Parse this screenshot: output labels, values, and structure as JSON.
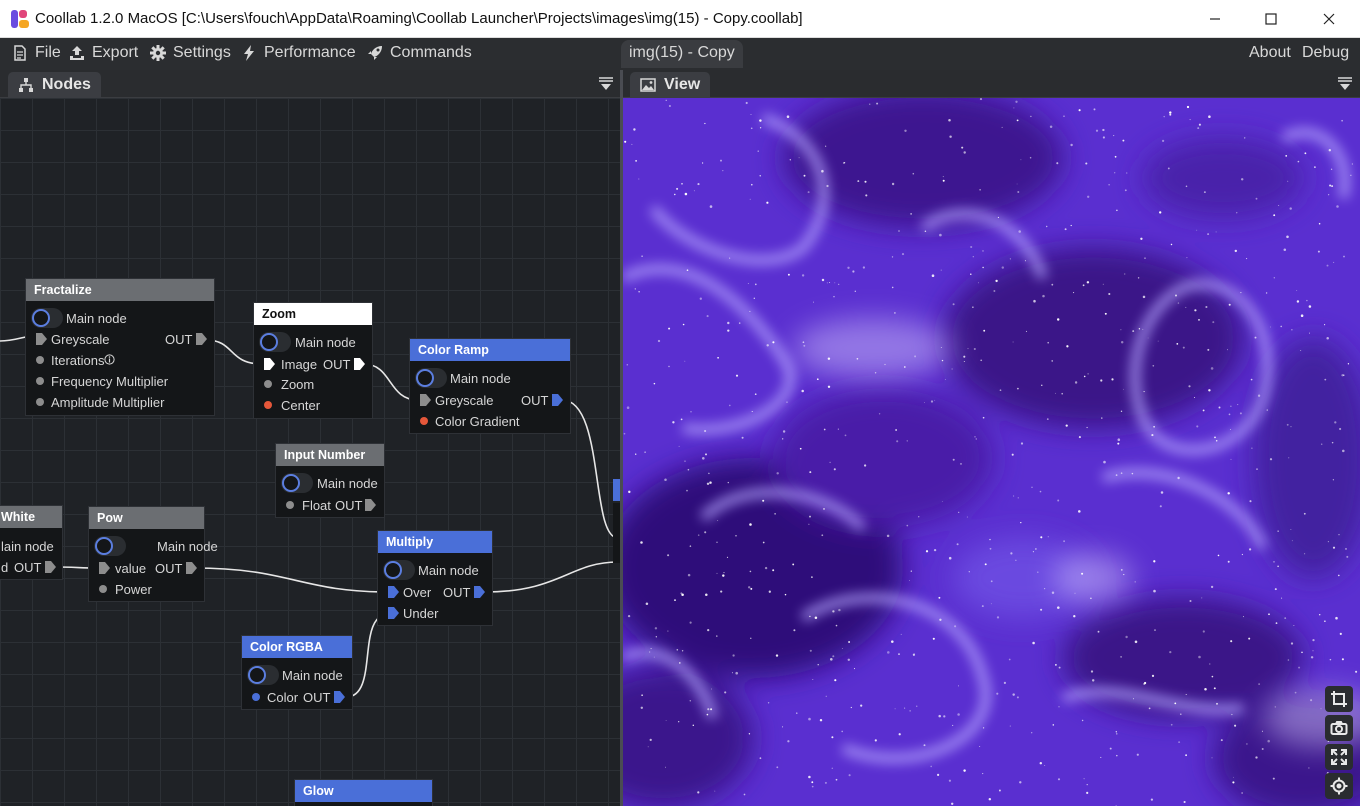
{
  "window": {
    "title": "Coollab 1.2.0 MacOS [C:\\Users\\fouch\\AppData\\Roaming\\Coollab Launcher\\Projects\\images\\img(15) - Copy.coollab]",
    "minimize_icon": "minimize-icon",
    "maximize_icon": "maximize-icon",
    "close_icon": "close-icon"
  },
  "menubar": {
    "items": [
      {
        "label": "File",
        "icon": "file-icon"
      },
      {
        "label": "Export",
        "icon": "export-icon"
      },
      {
        "label": "Settings",
        "icon": "gear-icon"
      },
      {
        "label": "Performance",
        "icon": "lightning-icon"
      },
      {
        "label": "Commands",
        "icon": "rocket-icon"
      }
    ],
    "document_tab": "img(15) - Copy",
    "right": [
      "About",
      "Debug"
    ]
  },
  "panels": {
    "nodes_tab": "Nodes",
    "view_tab": "View"
  },
  "nodes": {
    "fractalize": {
      "title": "Fractalize",
      "main": "Main node",
      "greyscale": "Greyscale",
      "out": "OUT",
      "iterations": "Iterations",
      "freq": "Frequency Multiplier",
      "amp": "Amplitude Multiplier"
    },
    "zoom": {
      "title": "Zoom",
      "main": "Main node",
      "image": "Image",
      "out": "OUT",
      "zoom": "Zoom",
      "center": "Center"
    },
    "color_ramp": {
      "title": "Color Ramp",
      "main": "Main node",
      "greyscale": "Greyscale",
      "out": "OUT",
      "gradient": "Color Gradient"
    },
    "input_number": {
      "title": "Input Number",
      "main": "Main node",
      "float": "Float",
      "out": "OUT"
    },
    "white": {
      "title": "White",
      "main": "lain node",
      "in": "d",
      "out": "OUT"
    },
    "pow": {
      "title": "Pow",
      "main": "Main node",
      "value": "value",
      "out": "OUT",
      "power": "Power"
    },
    "multiply": {
      "title": "Multiply",
      "main": "Main node",
      "over": "Over",
      "out": "OUT",
      "under": "Under"
    },
    "color_rgba": {
      "title": "Color RGBA",
      "main": "Main node",
      "color": "Color",
      "out": "OUT"
    },
    "glow": {
      "title": "Glow"
    }
  },
  "view_toolbar": [
    "crop-icon",
    "camera-icon",
    "fullscreen-icon",
    "target-icon"
  ],
  "colors": {
    "accent_blue": "#4a6fd8",
    "node_gray": "#6b6e72",
    "wire": "#e0e0e0",
    "center_pin": "#e5573a"
  }
}
